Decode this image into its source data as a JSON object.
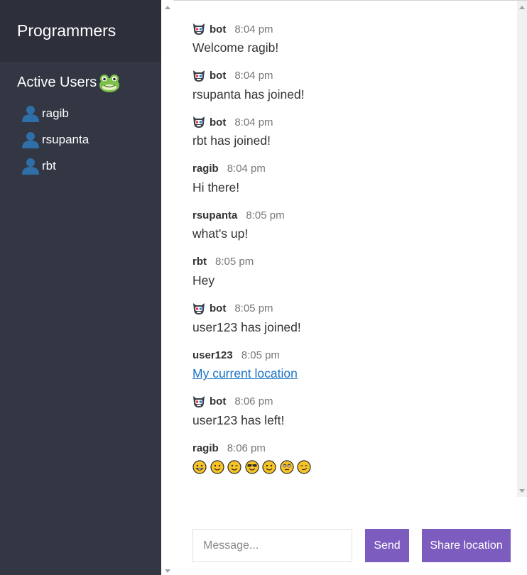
{
  "room": {
    "title": "Programmers"
  },
  "sidebar": {
    "heading": "Active Users",
    "users": [
      {
        "name": "ragib"
      },
      {
        "name": "rsupanta"
      },
      {
        "name": "rbt"
      }
    ]
  },
  "messages": [
    {
      "user": "bot",
      "time": "8:04 pm",
      "text": "Welcome ragib!",
      "bot": true
    },
    {
      "user": "bot",
      "time": "8:04 pm",
      "text": "rsupanta has joined!",
      "bot": true
    },
    {
      "user": "bot",
      "time": "8:04 pm",
      "text": "rbt has joined!",
      "bot": true
    },
    {
      "user": "ragib",
      "time": "8:04 pm",
      "text": "Hi there!"
    },
    {
      "user": "rsupanta",
      "time": "8:05 pm",
      "text": "what's up!"
    },
    {
      "user": "rbt",
      "time": "8:05 pm",
      "text": "Hey"
    },
    {
      "user": "bot",
      "time": "8:05 pm",
      "text": "user123 has joined!",
      "bot": true
    },
    {
      "user": "user123",
      "time": "8:05 pm",
      "link": "My current location"
    },
    {
      "user": "bot",
      "time": "8:06 pm",
      "text": "user123 has left!",
      "bot": true
    },
    {
      "user": "ragib",
      "time": "8:06 pm",
      "emojis": [
        "grinning-face",
        "smiling-face",
        "winking-face",
        "sunglasses-face",
        "slight-smile-face",
        "eye-roll-face",
        "smirking-face"
      ]
    }
  ],
  "composer": {
    "placeholder": "Message...",
    "send_label": "Send",
    "share_location_label": "Share location"
  },
  "colors": {
    "sidebar": "#333744",
    "sidebar_header": "#2d2f3a",
    "button": "#7c5cbf",
    "link": "#1a73c4",
    "emoji": "#f7c325"
  },
  "icons": {
    "users_heading": "frog-icon",
    "user": "user-icon",
    "bot": "bot-icon"
  }
}
